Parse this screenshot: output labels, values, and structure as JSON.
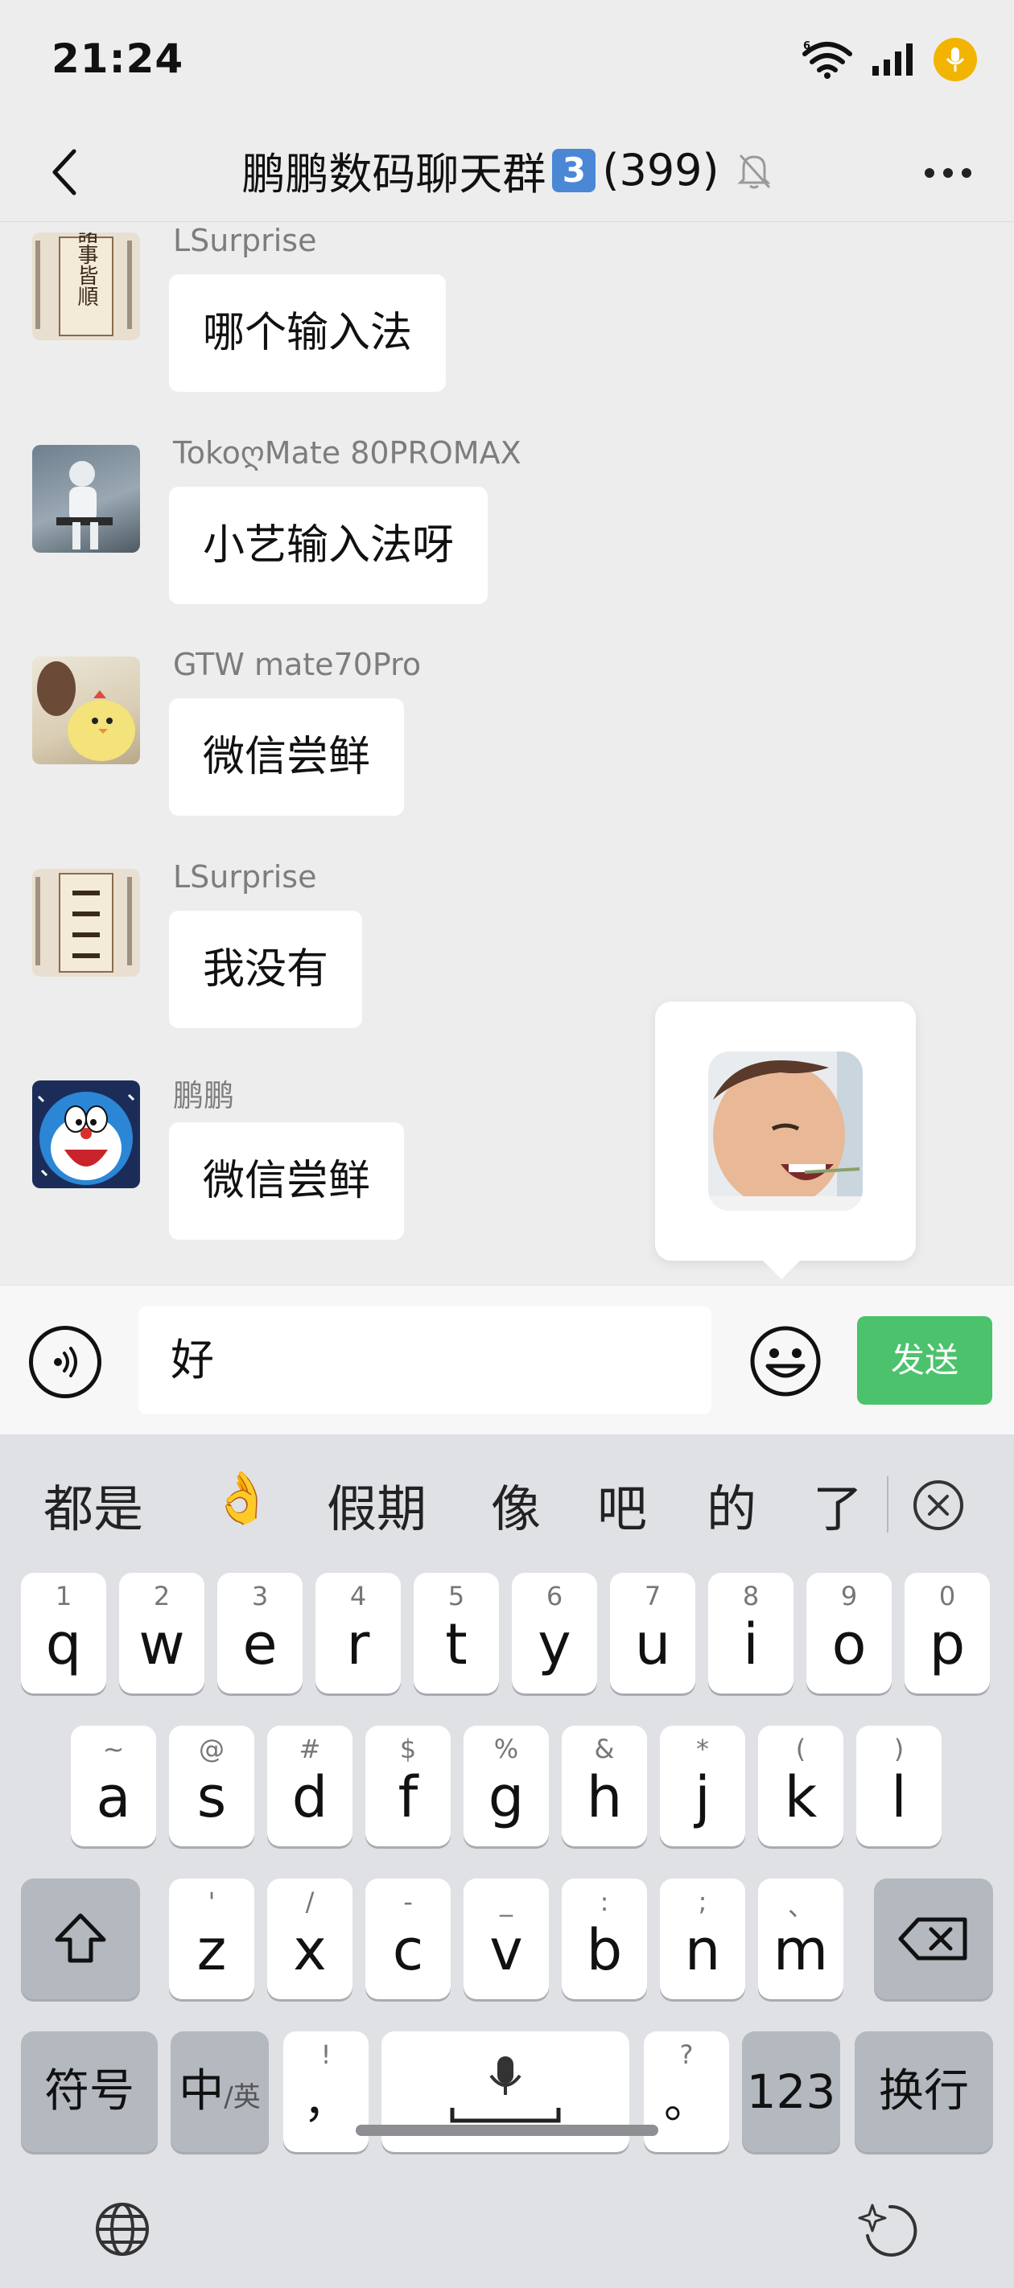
{
  "status_bar": {
    "time": "21:24",
    "network": "6"
  },
  "nav": {
    "title": "鹏鹏数码聊天群",
    "badge": "3",
    "member_count": "(399)"
  },
  "messages": [
    {
      "sender": "LSurprise",
      "text": "哪个输入法"
    },
    {
      "sender": "TokoღMate 80PROMAX",
      "text": "小艺输入法呀"
    },
    {
      "sender": "GTW  mate70Pro",
      "text": "微信尝鲜"
    },
    {
      "sender": "LSurprise",
      "text": "我没有"
    },
    {
      "sender": "鹏鹏",
      "text": "微信尝鲜"
    }
  ],
  "avatar_texts": {
    "scroll": "諸事皆順"
  },
  "input": {
    "value": "好",
    "send_label": "发送"
  },
  "candidates": [
    "都是",
    "👌",
    "假期",
    "像",
    "吧",
    "的",
    "了"
  ],
  "keyboard": {
    "row1": [
      {
        "hint": "1",
        "key": "q"
      },
      {
        "hint": "2",
        "key": "w"
      },
      {
        "hint": "3",
        "key": "e"
      },
      {
        "hint": "4",
        "key": "r"
      },
      {
        "hint": "5",
        "key": "t"
      },
      {
        "hint": "6",
        "key": "y"
      },
      {
        "hint": "7",
        "key": "u"
      },
      {
        "hint": "8",
        "key": "i"
      },
      {
        "hint": "9",
        "key": "o"
      },
      {
        "hint": "0",
        "key": "p"
      }
    ],
    "row2": [
      {
        "hint": "~",
        "key": "a"
      },
      {
        "hint": "@",
        "key": "s"
      },
      {
        "hint": "#",
        "key": "d"
      },
      {
        "hint": "$",
        "key": "f"
      },
      {
        "hint": "%",
        "key": "g"
      },
      {
        "hint": "&",
        "key": "h"
      },
      {
        "hint": "*",
        "key": "j"
      },
      {
        "hint": "(",
        "key": "k"
      },
      {
        "hint": ")",
        "key": "l"
      }
    ],
    "row3": [
      {
        "hint": "'",
        "key": "z"
      },
      {
        "hint": "/",
        "key": "x"
      },
      {
        "hint": "-",
        "key": "c"
      },
      {
        "hint": "_",
        "key": "v"
      },
      {
        "hint": ":",
        "key": "b"
      },
      {
        "hint": ";",
        "key": "n"
      },
      {
        "hint": "、",
        "key": "m"
      }
    ],
    "symbols_label": "符号",
    "lang_main": "中",
    "lang_sub": "/英",
    "comma_hint": "!",
    "comma_key": "，",
    "period_hint": "?",
    "period_key": "。",
    "num_label": "123",
    "enter_label": "换行"
  },
  "colors": {
    "send": "#4cc26c",
    "badge": "#4a88d6",
    "mic_dot": "#f2b400"
  }
}
